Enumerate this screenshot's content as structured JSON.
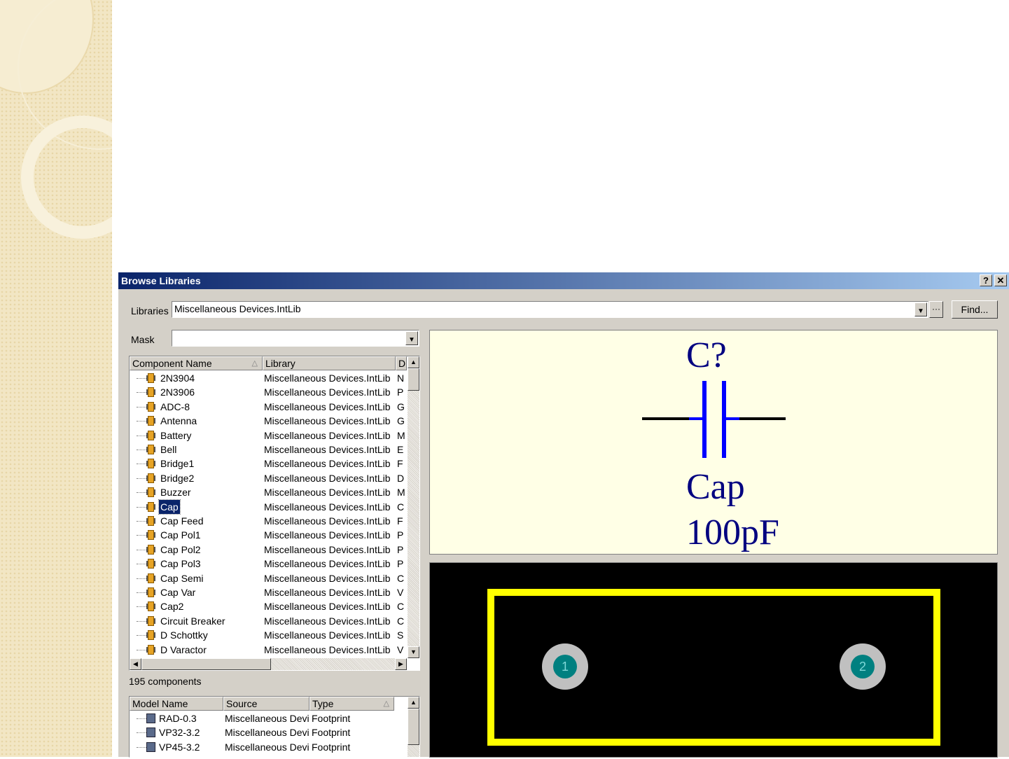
{
  "dialog": {
    "title": "Browse Libraries",
    "help_label": "?",
    "close_label": "✕"
  },
  "libraries": {
    "label": "Libraries",
    "value": "Miscellaneous Devices.IntLib",
    "more_label": "···",
    "find_label": "Find..."
  },
  "mask": {
    "label": "Mask",
    "value": ""
  },
  "components": {
    "headers": {
      "name": "Component Name",
      "library": "Library",
      "desc": "D"
    },
    "rows": [
      {
        "name": "2N3904",
        "library": "Miscellaneous Devices.IntLib",
        "desc": "N"
      },
      {
        "name": "2N3906",
        "library": "Miscellaneous Devices.IntLib",
        "desc": "P"
      },
      {
        "name": "ADC-8",
        "library": "Miscellaneous Devices.IntLib",
        "desc": "G"
      },
      {
        "name": "Antenna",
        "library": "Miscellaneous Devices.IntLib",
        "desc": "G"
      },
      {
        "name": "Battery",
        "library": "Miscellaneous Devices.IntLib",
        "desc": "M"
      },
      {
        "name": "Bell",
        "library": "Miscellaneous Devices.IntLib",
        "desc": "E"
      },
      {
        "name": "Bridge1",
        "library": "Miscellaneous Devices.IntLib",
        "desc": "F"
      },
      {
        "name": "Bridge2",
        "library": "Miscellaneous Devices.IntLib",
        "desc": "D"
      },
      {
        "name": "Buzzer",
        "library": "Miscellaneous Devices.IntLib",
        "desc": "M"
      },
      {
        "name": "Cap",
        "library": "Miscellaneous Devices.IntLib",
        "desc": "C"
      },
      {
        "name": "Cap Feed",
        "library": "Miscellaneous Devices.IntLib",
        "desc": "F"
      },
      {
        "name": "Cap Pol1",
        "library": "Miscellaneous Devices.IntLib",
        "desc": "P"
      },
      {
        "name": "Cap Pol2",
        "library": "Miscellaneous Devices.IntLib",
        "desc": "P"
      },
      {
        "name": "Cap Pol3",
        "library": "Miscellaneous Devices.IntLib",
        "desc": "P"
      },
      {
        "name": "Cap Semi",
        "library": "Miscellaneous Devices.IntLib",
        "desc": "C"
      },
      {
        "name": "Cap Var",
        "library": "Miscellaneous Devices.IntLib",
        "desc": "V"
      },
      {
        "name": "Cap2",
        "library": "Miscellaneous Devices.IntLib",
        "desc": "C"
      },
      {
        "name": "Circuit Breaker",
        "library": "Miscellaneous Devices.IntLib",
        "desc": "C"
      },
      {
        "name": "D Schottky",
        "library": "Miscellaneous Devices.IntLib",
        "desc": "S"
      },
      {
        "name": "D Varactor",
        "library": "Miscellaneous Devices.IntLib",
        "desc": "V"
      }
    ],
    "selected_index": 9,
    "count_text": "195 components"
  },
  "models": {
    "headers": {
      "name": "Model Name",
      "source": "Source",
      "type": "Type"
    },
    "rows": [
      {
        "name": "RAD-0.3",
        "source": "Miscellaneous Devi",
        "type": "Footprint"
      },
      {
        "name": "VP32-3.2",
        "source": "Miscellaneous Devi",
        "type": "Footprint"
      },
      {
        "name": "VP45-3.2",
        "source": "Miscellaneous Devi",
        "type": "Footprint"
      }
    ]
  },
  "schematic_preview": {
    "designator": "C?",
    "comment": "Cap",
    "value": "100pF",
    "text_color": "#000080",
    "plate_color": "#0000ff"
  },
  "pcb_preview": {
    "pads": [
      "1",
      "2"
    ],
    "outline_color": "#ffff00",
    "pad_color": "#008080"
  }
}
